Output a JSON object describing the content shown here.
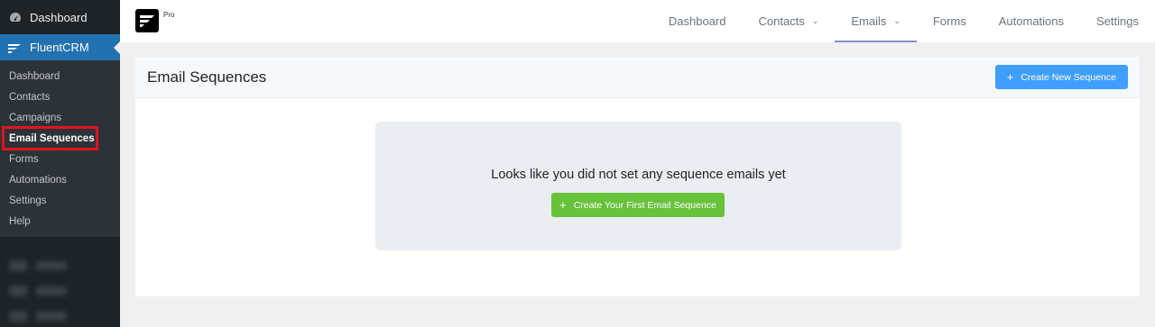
{
  "wp_menu": {
    "dashboard_label": "Dashboard",
    "fluentcrm_label": "FluentCRM",
    "submenu": [
      {
        "label": "Dashboard",
        "active": false
      },
      {
        "label": "Contacts",
        "active": false
      },
      {
        "label": "Campaigns",
        "active": false
      },
      {
        "label": "Email Sequences",
        "active": true
      },
      {
        "label": "Forms",
        "active": false
      },
      {
        "label": "Automations",
        "active": false
      },
      {
        "label": "Settings",
        "active": false
      },
      {
        "label": "Help",
        "active": false
      }
    ]
  },
  "topbar": {
    "badge": "Pro",
    "nav": [
      {
        "label": "Dashboard",
        "has_dropdown": false,
        "active": false
      },
      {
        "label": "Contacts",
        "has_dropdown": true,
        "active": false
      },
      {
        "label": "Emails",
        "has_dropdown": true,
        "active": true
      },
      {
        "label": "Forms",
        "has_dropdown": false,
        "active": false
      },
      {
        "label": "Automations",
        "has_dropdown": false,
        "active": false
      },
      {
        "label": "Settings",
        "has_dropdown": false,
        "active": false
      }
    ]
  },
  "page": {
    "title": "Email Sequences",
    "create_button": "Create New Sequence",
    "empty_message": "Looks like you did not set any sequence emails yet",
    "first_sequence_button": "Create Your First Email Sequence"
  },
  "colors": {
    "primary": "#409eff",
    "success": "#67c23a",
    "wp_active": "#2271b1",
    "highlight": "#e0141e"
  }
}
